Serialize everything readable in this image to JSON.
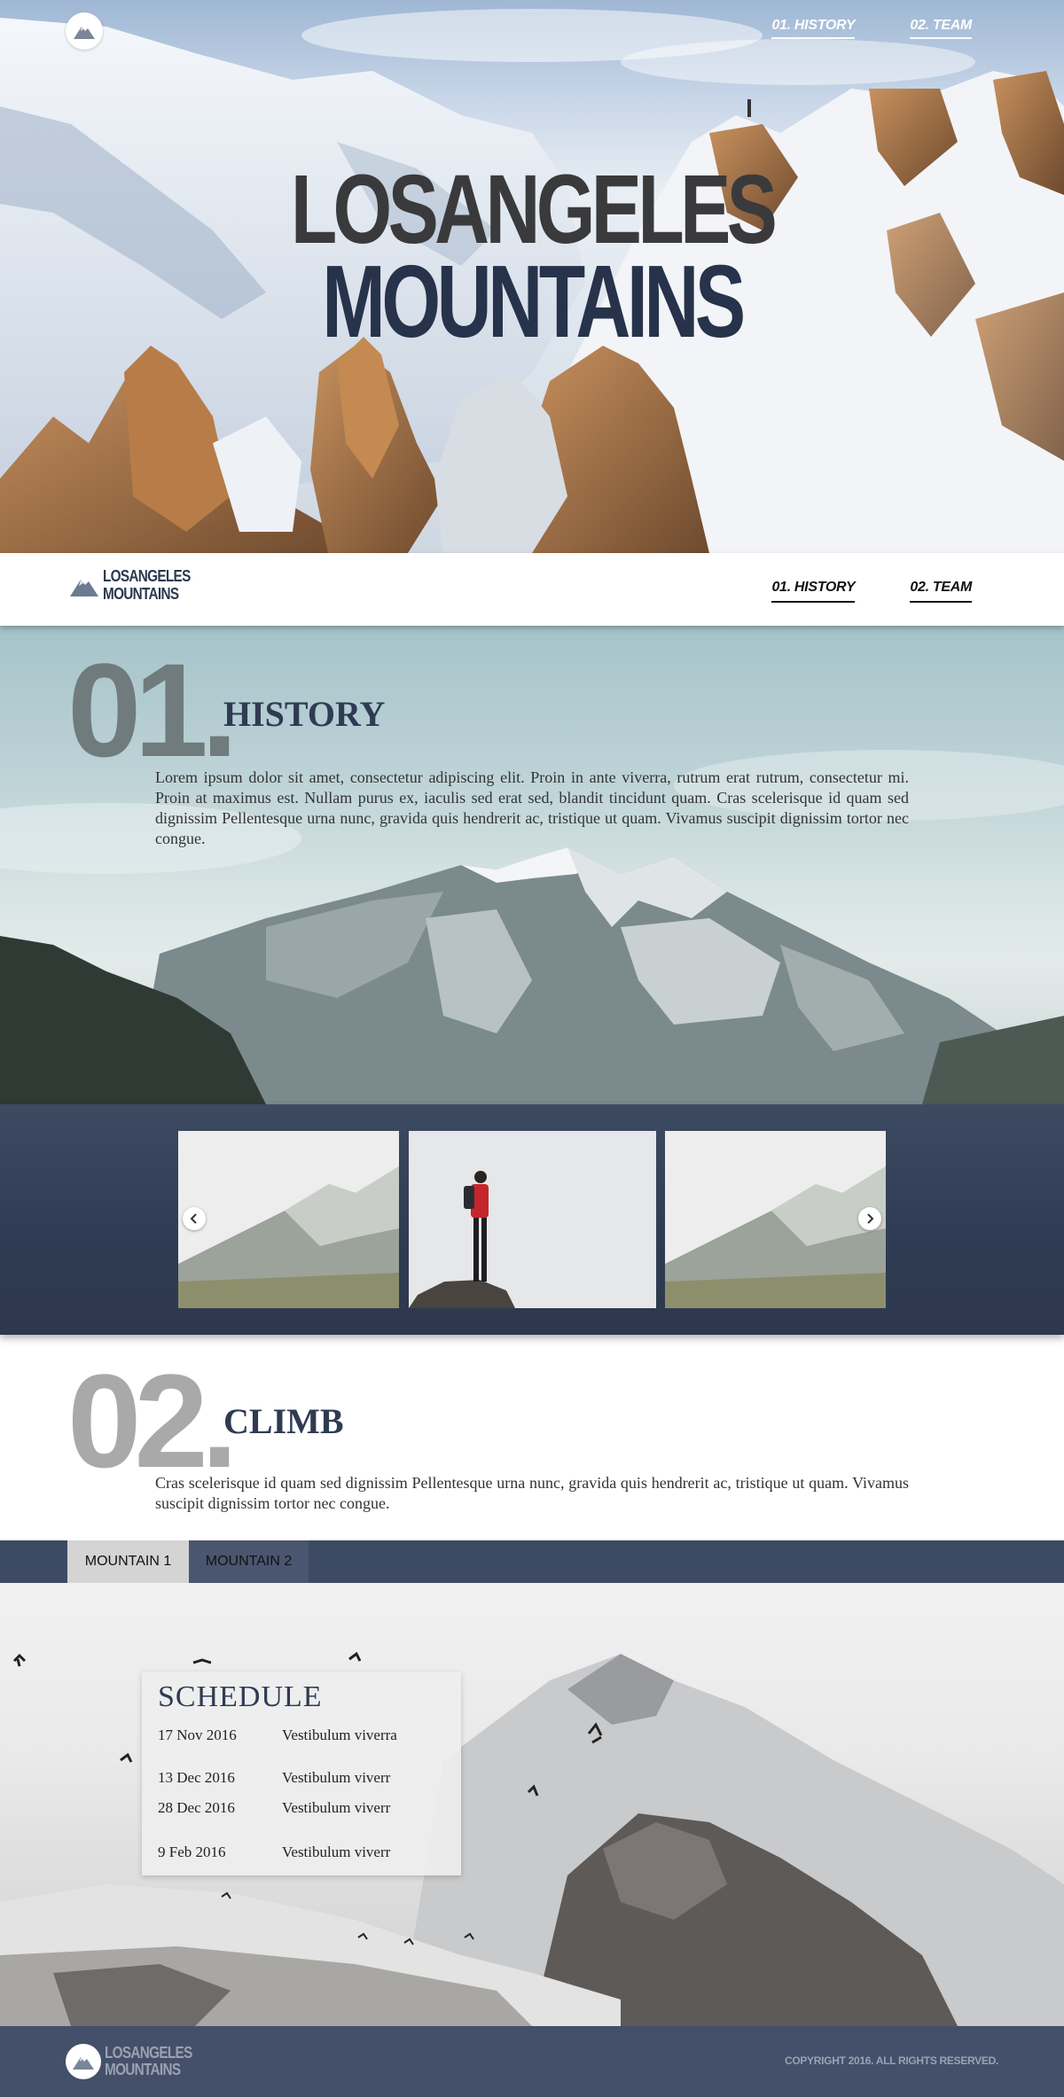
{
  "hero": {
    "title_line1": "LOSANGELES",
    "title_line2": "MOUNTAINS",
    "nav": [
      {
        "label": "01. HISTORY"
      },
      {
        "label": "02. TEAM"
      }
    ],
    "logo_icon": "mountain-logo-icon"
  },
  "navbar": {
    "logo_line1": "LOSANGELES",
    "logo_line2": "MOUNTAINS",
    "links": [
      {
        "label": "01. HISTORY"
      },
      {
        "label": "02. TEAM"
      }
    ]
  },
  "history": {
    "number": "01.",
    "title": "HISTORY",
    "body": "Lorem ipsum dolor sit amet, consectetur adipiscing elit. Proin in ante viverra, rutrum erat rutrum, consectetur mi. Proin at maximus est. Nullam purus ex, iaculis sed erat sed, blandit tincidunt quam. Cras scelerisque id quam sed dignissim Pellentesque urna nunc, gravida quis hendrerit ac, tristique ut quam. Vivamus suscipit dignissim tortor nec congue."
  },
  "gallery": {
    "prev_icon": "chevron-left-icon",
    "next_icon": "chevron-right-icon",
    "images": [
      "misty-valley",
      "hiker-on-rock",
      "misty-valley"
    ]
  },
  "climb": {
    "number": "02.",
    "title": "CLIMB",
    "body": "Cras scelerisque id quam sed dignissim Pellentesque urna nunc, gravida quis hendrerit ac, tristique ut quam. Vivamus suscipit dignissim tortor nec congue."
  },
  "tabs": [
    {
      "label": "MOUNTAIN 1",
      "active": true
    },
    {
      "label": "MOUNTAIN 2",
      "active": false
    }
  ],
  "schedule": {
    "title": "SCHEDULE",
    "rows": [
      {
        "date": "17 Nov 2016",
        "event": "Vestibulum viverra"
      },
      {
        "date": "13 Dec 2016",
        "event": "Vestibulum viverr"
      },
      {
        "date": "28 Dec 2016",
        "event": "Vestibulum viverr"
      },
      {
        "date": "9 Feb 2016",
        "event": "Vestibulum viverr"
      }
    ]
  },
  "footer": {
    "logo_line1": "LOSANGELES",
    "logo_line2": "MOUNTAINS",
    "copyright": "COPYRIGHT 2016.   ALL RIGHTS RESERVED."
  },
  "colors": {
    "navy": "#2f3b52",
    "tab_bar": "#3d4a63",
    "footer": "#44506a",
    "number_gray": "#a9a9a9"
  }
}
